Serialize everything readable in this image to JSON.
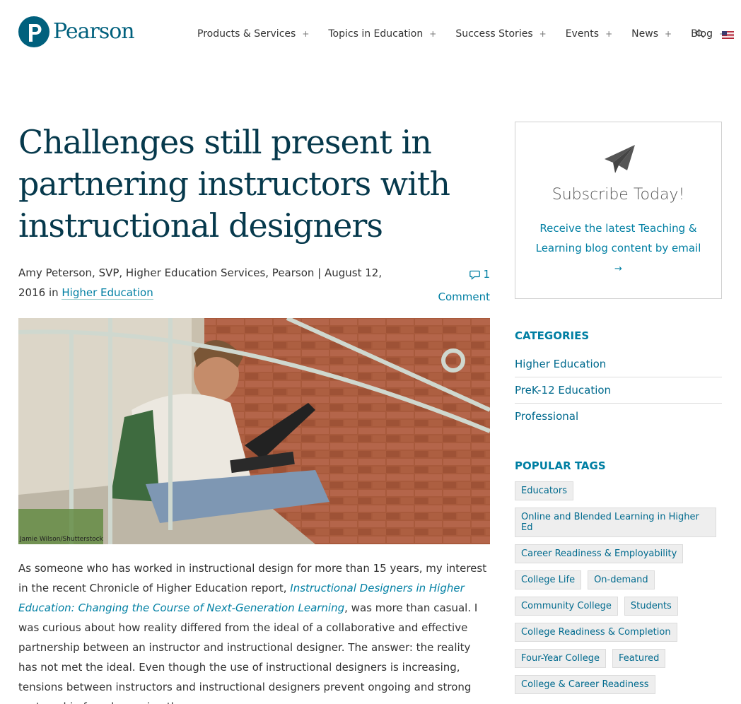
{
  "header": {
    "logo_text": "Pearson",
    "nav": [
      {
        "label": "Products & Services",
        "gap": 0
      },
      {
        "label": "Topics in Education",
        "gap": 0
      },
      {
        "label": "Success Stories",
        "gap": 0
      },
      {
        "label": "Events",
        "gap": 0
      },
      {
        "label": "News",
        "gap": 0
      },
      {
        "label": "Blog",
        "gap": 0
      }
    ],
    "plus": "+",
    "search_icon": "search-icon",
    "flag_icon": "us-flag-icon"
  },
  "article": {
    "title": "Challenges still present in partnering instructors with instructional designers",
    "meta_author": "Amy Peterson, SVP, Higher Education Services, Pearson | August 12, 2016 in ",
    "meta_category": "Higher Education",
    "comment_count": "1",
    "comment_label": "Comment",
    "image_credit": "Jamie Wilson/Shutterstock",
    "body_start": "As someone who has worked in instructional design for more than 15 years, my interest in the recent Chronicle of Higher Education report, ",
    "body_link": "Instructional Designers in Higher Education: Changing the Course of Next-Generation Learning",
    "body_end": ", was more than casual. I was curious about how reality differed from the ideal of a collaborative and effective partnership between an instructor and instructional designer. The answer: the reality has not met the ideal. Even though the use of instructional designers is increasing, tensions between instructors and instructional designers prevent ongoing and strong partnership from becoming the norm."
  },
  "sidebar": {
    "subscribe_title": "Subscribe Today!",
    "subscribe_text": "Receive the latest Teaching & Learning blog content by email",
    "subscribe_arrow": "→",
    "categories_heading": "CATEGORIES",
    "categories": [
      "Higher Education",
      "PreK-12 Education",
      "Professional"
    ],
    "tags_heading": "POPULAR TAGS",
    "tag_rows": [
      [
        "Educators"
      ],
      [
        "Online and Blended Learning in Higher Ed"
      ],
      [
        "Career Readiness & Employability"
      ],
      [
        "College Life",
        "On-demand"
      ],
      [
        "Community College",
        "Students"
      ],
      [
        "College Readiness & Completion"
      ],
      [
        "Four-Year College",
        "Featured"
      ],
      [
        "College & Career Readiness"
      ]
    ]
  },
  "colors": {
    "brand": "#00607d",
    "link": "#007fa3",
    "title": "#06394c"
  }
}
